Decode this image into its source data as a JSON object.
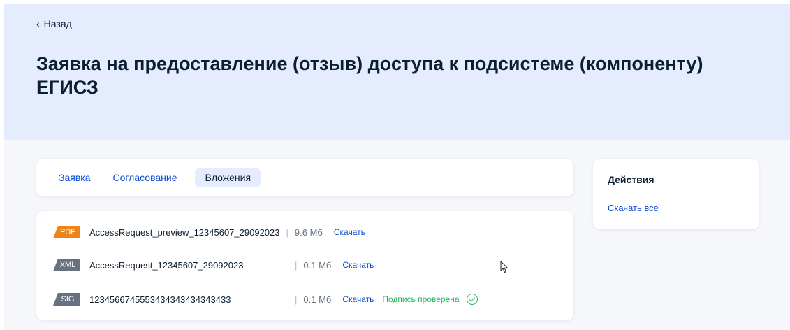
{
  "header": {
    "back_label": "Назад",
    "title": "Заявка на предоставление (отзыв) доступа к подсистеме (компоненту) ЕГИСЗ"
  },
  "tabs": [
    {
      "label": "Заявка",
      "active": false
    },
    {
      "label": "Согласование",
      "active": false
    },
    {
      "label": "Вложения",
      "active": true
    }
  ],
  "files": [
    {
      "type": "PDF",
      "name": "AccessRequest_preview_12345607_29092023",
      "size": "9.6 Мб",
      "download": "Скачать",
      "signature": ""
    },
    {
      "type": "XML",
      "name": "AccessRequest_12345607_29092023",
      "size": "0.1 Мб",
      "download": "Скачать",
      "signature": ""
    },
    {
      "type": "SIG",
      "name": "1234566745553434343434343433",
      "size": "0.1 Мб",
      "download": "Скачать",
      "signature": "Подпись проверена"
    }
  ],
  "separator": "|",
  "actions": {
    "title": "Действия",
    "download_all": "Скачать все"
  },
  "colors": {
    "header_bg": "#e4ecfd",
    "link": "#0d4cd3",
    "pdf_badge": "#ee8419",
    "gray_badge": "#66727f",
    "success": "#2bb85c"
  },
  "icons": {
    "back": "chevron-left-icon",
    "signature_ok": "check-circle-icon",
    "cursor": "mouse-pointer-icon"
  }
}
